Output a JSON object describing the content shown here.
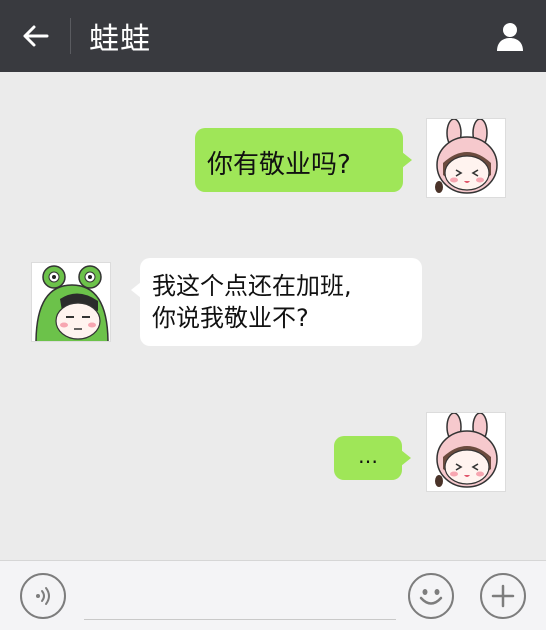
{
  "header": {
    "back_icon": "arrow-left-icon",
    "title": "蛙蛙",
    "profile_icon": "person-icon"
  },
  "messages": [
    {
      "side": "sent",
      "text": "你有敬业吗?",
      "avatar": "bunny-hood-girl-avatar"
    },
    {
      "side": "received",
      "text": "我这个点还在加班,\n你说我敬业不?",
      "avatar": "frog-hood-avatar"
    },
    {
      "side": "sent",
      "text": "…",
      "avatar": "bunny-hood-girl-avatar"
    }
  ],
  "input_bar": {
    "voice_icon": "voice-icon",
    "input_value": "",
    "emoji_icon": "emoji-icon",
    "add_icon": "plus-icon"
  },
  "colors": {
    "header_bg": "#393a3f",
    "chat_bg": "#ebebeb",
    "sent_bubble": "#9fe658",
    "received_bubble": "#ffffff",
    "bunny_hood": "#f6c9cd",
    "frog_hood": "#6cc24a"
  }
}
